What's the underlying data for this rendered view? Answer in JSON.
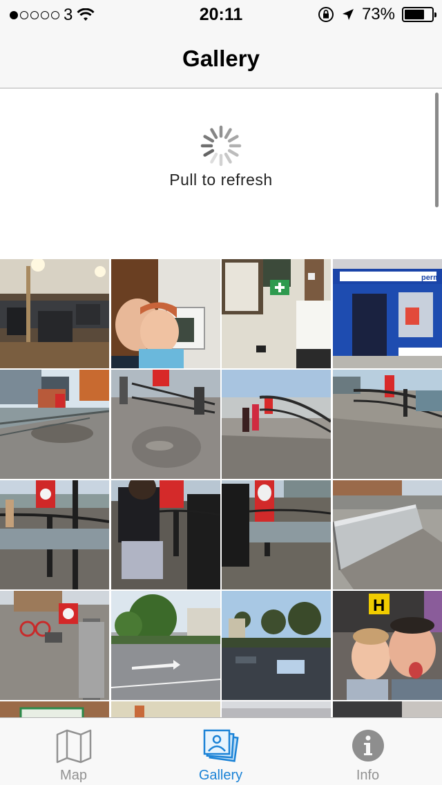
{
  "status_bar": {
    "carrier": "3",
    "time": "20:11",
    "battery": "73%",
    "battery_level": 0.73,
    "signal_bars": 1
  },
  "nav": {
    "title": "Gallery"
  },
  "refresh": {
    "label": "Pull to refresh"
  },
  "grid": {
    "columns": 4,
    "photos": [
      "gym-interior",
      "selfie-father-son",
      "noticeboard-first-aid",
      "blue-shopfront",
      "riverside-buildings",
      "cobbled-quay",
      "quay-walkers",
      "quay-railing-lifebuoy",
      "quay-woman-walking",
      "woman-back-view",
      "lifebuoy-person",
      "metal-ramp",
      "red-bicycle-quay",
      "street-trees",
      "river-reflection",
      "selfie-tongues"
    ]
  },
  "tab_bar": {
    "tabs": [
      {
        "label": "Map",
        "icon": "map-icon",
        "active": false
      },
      {
        "label": "Gallery",
        "icon": "gallery-icon",
        "active": true
      },
      {
        "label": "Info",
        "icon": "info-icon",
        "active": false
      }
    ]
  },
  "colors": {
    "accent": "#1a82d6",
    "inactive": "#929292",
    "bar_background": "#f7f7f7"
  }
}
